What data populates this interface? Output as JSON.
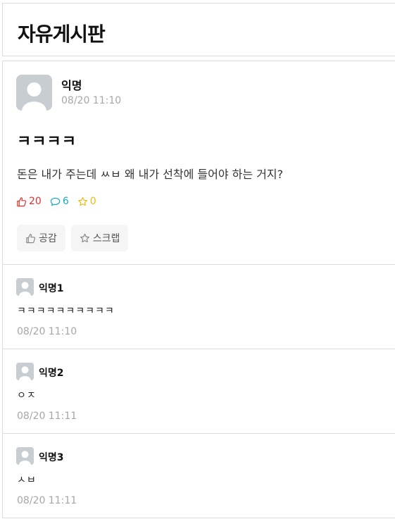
{
  "header": {
    "title": "자유게시판"
  },
  "post": {
    "author": "익명",
    "time": "08/20 11:10",
    "title": "ㅋㅋㅋㅋ",
    "body": "돈은 내가 주는데 ㅆㅂ 왜 내가 선착에 들어야 하는 거지?",
    "stats": {
      "likes": "20",
      "comments": "6",
      "scraps": "0"
    },
    "actions": {
      "like_label": "공감",
      "scrap_label": "스크랩"
    }
  },
  "comments": [
    {
      "author": "익명1",
      "text": "ㅋㅋㅋㅋㅋㅋㅋㅋㅋㅋ",
      "time": "08/20 11:10"
    },
    {
      "author": "익명2",
      "text": "ㅇㅈ",
      "time": "08/20 11:11"
    },
    {
      "author": "익명3",
      "text": "ㅅㅂ",
      "time": "08/20 11:11"
    }
  ],
  "colors": {
    "like": "#e0312c",
    "comment": "#17a8c9",
    "scrap": "#e6bb1a",
    "avatar_bg": "#c8cdd2"
  }
}
